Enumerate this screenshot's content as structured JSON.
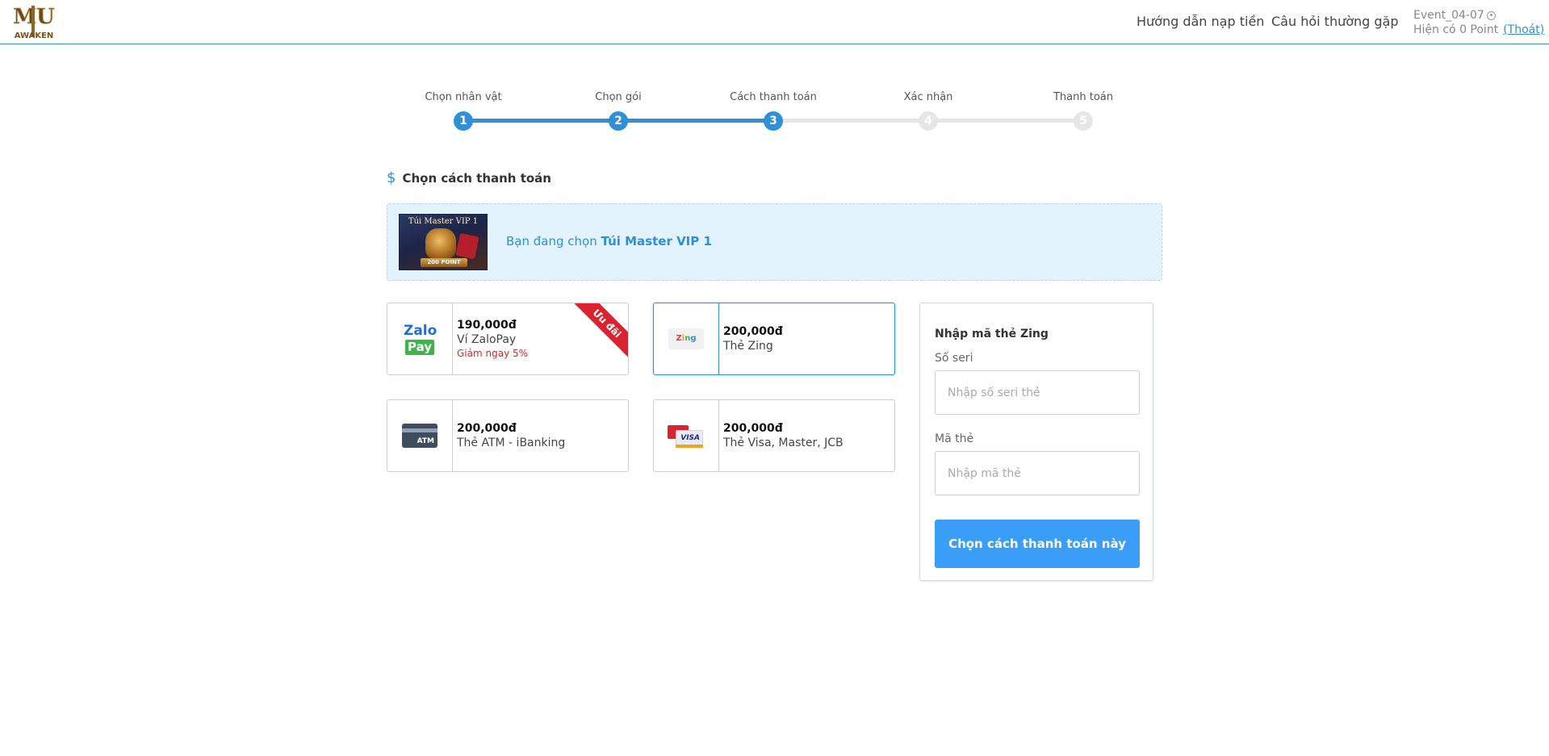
{
  "header": {
    "logo_text": "MU AWAKEN",
    "nav": [
      {
        "label": "Hướng dẫn nạp tiền"
      },
      {
        "label": "Câu hỏi thường gặp"
      }
    ],
    "user": {
      "name": "Event_04-07",
      "points_text": "Hiện có 0 Point",
      "logout_label": "(Thoát)"
    }
  },
  "steps": [
    {
      "label": "Chọn nhân vật",
      "number": "1",
      "active": true
    },
    {
      "label": "Chọn gói",
      "number": "2",
      "active": true
    },
    {
      "label": "Cách thanh toán",
      "number": "3",
      "active": true
    },
    {
      "label": "Xác nhận",
      "number": "4",
      "active": false
    },
    {
      "label": "Thanh toán",
      "number": "5",
      "active": false
    }
  ],
  "section": {
    "icon": "$",
    "title": "Chọn cách thanh toán"
  },
  "selected": {
    "prefix": "Bạn đang chọn",
    "package_name": "Túi Master VIP 1",
    "image_title": "Túi Master VIP 1",
    "image_point": "200 POINT"
  },
  "payments": {
    "zalo": {
      "price": "190,000đ",
      "method": "Ví ZaloPay",
      "promo": "Giảm ngay 5%",
      "ribbon": "Ưu đãi",
      "logo_top": "Zalo",
      "logo_bottom": "Pay"
    },
    "zing": {
      "price": "200,000đ",
      "method": "Thẻ Zing",
      "logo": "Zing"
    },
    "atm": {
      "price": "200,000đ",
      "method": "Thẻ ATM - iBanking",
      "logo": "ATM"
    },
    "visa": {
      "price": "200,000đ",
      "method": "Thẻ Visa, Master, JCB",
      "logo": "VISA"
    }
  },
  "form": {
    "title": "Nhập mã thẻ Zing",
    "serial_label": "Số seri",
    "serial_placeholder": "Nhập số seri thẻ",
    "code_label": "Mã thẻ",
    "code_placeholder": "Nhập mã thẻ",
    "submit_label": "Chọn cách thanh toán này"
  },
  "colors": {
    "accent": "#2f8fd8",
    "button": "#3a9ef8",
    "promo": "#d9242f",
    "selected_bg": "#e3f3fd"
  }
}
